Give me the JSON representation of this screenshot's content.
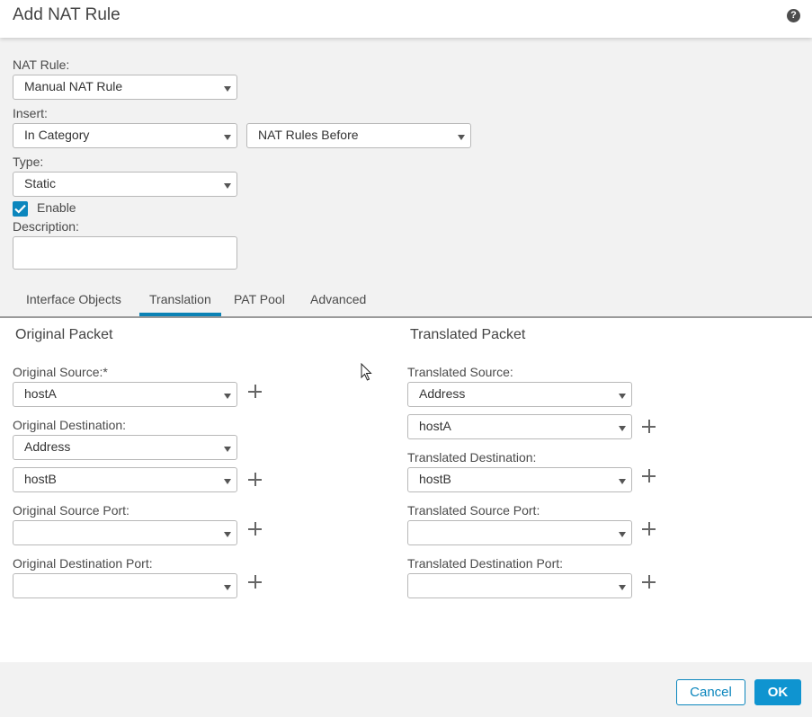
{
  "dialog": {
    "title": "Add NAT Rule",
    "help_icon": "question-circle-icon"
  },
  "general": {
    "nat_rule": {
      "label": "NAT Rule:",
      "value": "Manual NAT Rule"
    },
    "insert": {
      "label": "Insert:",
      "value": "In Category",
      "position_value": "NAT Rules Before"
    },
    "type": {
      "label": "Type:",
      "value": "Static"
    },
    "enable": {
      "label": "Enable",
      "checked": true
    },
    "description": {
      "label": "Description:",
      "value": ""
    }
  },
  "tabs": [
    {
      "label": "Interface Objects",
      "active": false
    },
    {
      "label": "Translation",
      "active": true
    },
    {
      "label": "PAT Pool",
      "active": false
    },
    {
      "label": "Advanced",
      "active": false
    }
  ],
  "original_packet": {
    "title": "Original Packet",
    "source": {
      "label": "Original Source:*",
      "value": "hostA"
    },
    "destination": {
      "label": "Original Destination:",
      "type_value": "Address",
      "value": "hostB"
    },
    "source_port": {
      "label": "Original Source Port:",
      "value": ""
    },
    "destination_port": {
      "label": "Original Destination Port:",
      "value": ""
    }
  },
  "translated_packet": {
    "title": "Translated Packet",
    "source": {
      "label": "Translated Source:",
      "type_value": "Address",
      "value": "hostA"
    },
    "destination": {
      "label": "Translated Destination:",
      "value": "hostB"
    },
    "source_port": {
      "label": "Translated Source Port:",
      "value": ""
    },
    "destination_port": {
      "label": "Translated Destination Port:",
      "value": ""
    }
  },
  "footer": {
    "cancel_label": "Cancel",
    "ok_label": "OK"
  },
  "colors": {
    "accent": "#0b86bd",
    "primary_button": "#0f94d0",
    "panel_bg": "#f2f2f2"
  }
}
